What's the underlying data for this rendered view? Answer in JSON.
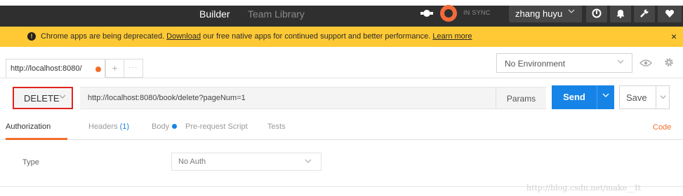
{
  "topbar": {
    "builder_label": "Builder",
    "team_library_label": "Team Library",
    "sync_label": "IN SYNC",
    "user_name": "zhang huyu",
    "colors": {
      "bar": "#2f2f2f",
      "sync_accent": "#f26b3a"
    }
  },
  "banner": {
    "message_before": "Chrome apps are being deprecated. ",
    "download_link": "Download",
    "message_after": " our free native apps for continued support and better performance. ",
    "learn_more_link": "Learn more",
    "close_glyph": "×",
    "color": "#fec934"
  },
  "tabs": {
    "request_tab_label": "http://localhost:8080/",
    "add_glyph": "+",
    "more_glyph": "···"
  },
  "environment": {
    "selected": "No Environment"
  },
  "request": {
    "method": "DELETE",
    "url": "http://localhost:8080/book/delete?pageNum=1",
    "params_label": "Params",
    "send_label": "Send",
    "save_label": "Save",
    "send_color": "#1684e7"
  },
  "subtabs": {
    "authorization": "Authorization",
    "headers": "Headers",
    "headers_count": "(1)",
    "body": "Body",
    "prerequest": "Pre-request Script",
    "tests": "Tests",
    "code": "Code",
    "active_color": "#f36d29"
  },
  "auth": {
    "type_label": "Type",
    "selected": "No Auth"
  },
  "watermark": "http://blog.csdn.net/make__It",
  "icons": {
    "satellite": "satellite-icon",
    "sync": "sync-icon",
    "history": "history-icon",
    "bell": "bell-icon",
    "wrench": "wrench-icon",
    "heart": "heart-icon",
    "eye": "eye-icon",
    "gear": "gear-icon"
  }
}
